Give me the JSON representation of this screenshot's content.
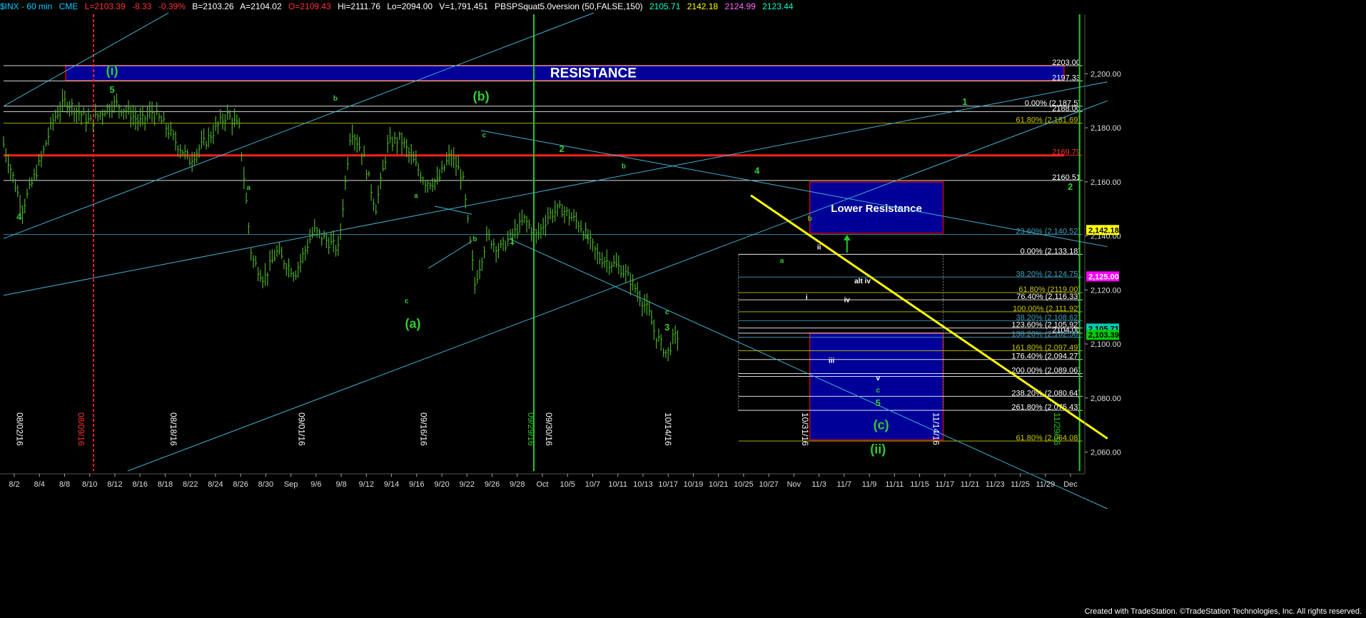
{
  "header": {
    "symbol": "$INX - 60 min",
    "exchange": "CME",
    "last": "L=2103.39",
    "change": "-8.33",
    "change_pct": "-0.39%",
    "bid": "B=2103.26",
    "ask": "A=2104.02",
    "open": "O=2109.43",
    "high": "Hi=2111.76",
    "low": "Lo=2094.00",
    "volume": "V=1,791,451",
    "study": "PBSPSquat5.0version (50,FALSE,150)",
    "study_values": [
      "2105.71",
      "2142.18",
      "2124.99",
      "2123.44"
    ],
    "colors": {
      "symbol": "#00ccff",
      "last": "#ff3333",
      "quotes": "#ffffff",
      "study": "#00ccff",
      "study_values": [
        "#00ffcc",
        "#ffff00",
        "#ff66ff",
        "#00ffcc"
      ]
    }
  },
  "footer": "Created with TradeStation. ©TradeStation Technologies, Inc. All rights reserved.",
  "chart_data": {
    "type": "candlestick",
    "title": "",
    "interval": "60 min",
    "x_ticks": [
      "8/2",
      "8/4",
      "8/8",
      "8/10",
      "8/12",
      "8/16",
      "8/18",
      "8/22",
      "8/24",
      "8/26",
      "8/30",
      "Sep",
      "9/6",
      "9/8",
      "9/12",
      "9/14",
      "9/16",
      "9/20",
      "9/22",
      "9/26",
      "9/28",
      "Oct",
      "10/5",
      "10/7",
      "10/11",
      "10/13",
      "10/17",
      "10/19",
      "10/21",
      "10/25",
      "10/27",
      "Nov",
      "11/3",
      "11/7",
      "11/9",
      "11/11",
      "11/15",
      "11/17",
      "11/21",
      "11/23",
      "11/25",
      "11/29",
      "Dec"
    ],
    "y_ticks": [
      2060,
      2080,
      2100,
      2120,
      2140,
      2160,
      2180,
      2200
    ],
    "ylim": [
      2053,
      2222
    ],
    "y_tick_labels": [
      "2,060.00",
      "2,080.00",
      "2,100.00",
      "2,120.00",
      "2,140.00",
      "2,160.00",
      "2,180.00",
      "2,200.00"
    ],
    "grid": false,
    "price_path": [
      [
        0,
        2174
      ],
      [
        3,
        2150
      ],
      [
        6,
        2168
      ],
      [
        8,
        2183
      ],
      [
        10,
        2190
      ],
      [
        12,
        2186
      ],
      [
        14,
        2182
      ],
      [
        16,
        2186
      ],
      [
        18,
        2189
      ],
      [
        20,
        2186
      ],
      [
        22,
        2182
      ],
      [
        24,
        2186
      ],
      [
        26,
        2181
      ],
      [
        28,
        2174
      ],
      [
        30,
        2168
      ],
      [
        33,
        2176
      ],
      [
        36,
        2185
      ],
      [
        38,
        2180
      ],
      [
        40,
        2132
      ],
      [
        42,
        2124
      ],
      [
        44,
        2134
      ],
      [
        47,
        2126
      ],
      [
        50,
        2142
      ],
      [
        54,
        2135
      ],
      [
        56,
        2180
      ],
      [
        58,
        2170
      ],
      [
        60,
        2150
      ],
      [
        62,
        2174
      ],
      [
        64,
        2176
      ],
      [
        66,
        2168
      ],
      [
        68,
        2160
      ],
      [
        70,
        2160
      ],
      [
        72,
        2170
      ],
      [
        74,
        2162
      ],
      [
        76,
        2122
      ],
      [
        78,
        2140
      ],
      [
        80,
        2135
      ],
      [
        82,
        2140
      ],
      [
        84,
        2146
      ],
      [
        86,
        2140
      ],
      [
        88,
        2148
      ],
      [
        90,
        2150
      ],
      [
        93,
        2144
      ],
      [
        96,
        2132
      ],
      [
        98,
        2130
      ],
      [
        99.5,
        2128
      ],
      [
        101,
        2124
      ],
      [
        102.5,
        2118
      ],
      [
        104,
        2112
      ],
      [
        105,
        2104
      ],
      [
        106,
        2100
      ],
      [
        107,
        2096
      ],
      [
        108,
        2102
      ],
      [
        109,
        2103.4
      ]
    ],
    "x_range": [
      0,
      174
    ],
    "vertical_date_labels": [
      "08/02/16",
      "08/09/16",
      "08/18/16",
      "09/01/16",
      "09/16/16",
      "09/29/16",
      "09/30/16",
      "10/14/16",
      "10/31/16",
      "11/14/16",
      "11/29/16"
    ],
    "horizontal_levels": [
      {
        "value": 2203.0,
        "label": "2203.00",
        "color": "#ffffff"
      },
      {
        "value": 2197.33,
        "label": "2197.33",
        "color": "#ffffff"
      },
      {
        "value": 2188.0,
        "label": "0.00% (2,187.5)",
        "color": "#ffffff"
      },
      {
        "value": 2186.0,
        "label": "2188.00",
        "color": "#ffffff"
      },
      {
        "value": 2181.69,
        "label": "61.80% (2,181.69)",
        "color": "#c8c800"
      },
      {
        "value": 2169.79,
        "label": "2169.79",
        "color": "#ff3030"
      },
      {
        "value": 2160.51,
        "label": "2160.51",
        "color": "#ffffff"
      },
      {
        "value": 2140.52,
        "label": "23.60% (2,140.52)",
        "color": "#40a0c0"
      },
      {
        "value": 2133.18,
        "label": "0.00% (2,133.18)",
        "color": "#ffffff"
      },
      {
        "value": 2124.75,
        "label": "38.20% (2,124.75)",
        "color": "#40a0c0"
      },
      {
        "value": 2119.0,
        "label": "61.80% (2119.00)",
        "color": "#c8c800"
      },
      {
        "value": 2116.33,
        "label": "76.40% (2,116.33)",
        "color": "#ffffff"
      },
      {
        "value": 2111.92,
        "label": "100.00% (2,111.92)",
        "color": "#c8c800"
      },
      {
        "value": 2108.62,
        "label": "38.20% (2,108.62)",
        "color": "#40a0c0"
      },
      {
        "value": 2105.92,
        "label": "123.60% (2,105.92)",
        "color": "#ffffff"
      },
      {
        "value": 2104.0,
        "label": "2104.00",
        "color": "#ffffff"
      },
      {
        "value": 2102.5,
        "label": "138.20% (2,102.50)",
        "color": "#40a0c0"
      },
      {
        "value": 2097.49,
        "label": "161.80% (2,097.49)",
        "color": "#c8c800"
      },
      {
        "value": 2094.27,
        "label": "176.40% (2,094.27)",
        "color": "#ffffff"
      },
      {
        "value": 2089.06,
        "label": "200.00% (2,089.06)",
        "color": "#ffffff"
      },
      {
        "value": 2088.0,
        "label": "",
        "color": "#ffffff"
      },
      {
        "value": 2080.64,
        "label": "238.20% (2,080.64)",
        "color": "#ffffff"
      },
      {
        "value": 2075.43,
        "label": "261.80% (2,075.43)",
        "color": "#ffffff"
      },
      {
        "value": 2064.08,
        "label": "61.80% (2,064.08)",
        "color": "#c8c800"
      }
    ],
    "price_tags": [
      {
        "value": 2142.18,
        "label": "2,142.18",
        "bg": "#ffff00",
        "fg": "#000000"
      },
      {
        "value": 2125.0,
        "label": "2,125.00",
        "bg": "#ff00ff",
        "fg": "#ffffff"
      },
      {
        "value": 2105.71,
        "label": "2,105.71",
        "bg": "#00ccaa",
        "fg": "#000000"
      },
      {
        "value": 2103.39,
        "label": "2,103.39",
        "bg": "#00cc00",
        "fg": "#000000"
      }
    ],
    "zones": [
      {
        "label": "RESISTANCE",
        "x0": 10,
        "x1": 171,
        "y0": 2197.5,
        "y1": 2203,
        "fill": "#000099",
        "stroke": "#cc0000"
      },
      {
        "label": "Lower Resistance",
        "x0": 130,
        "x1": 151.5,
        "y0": 2141,
        "y1": 2160,
        "fill": "#000099",
        "stroke": "#cc0000"
      },
      {
        "label": "",
        "x0": 130,
        "x1": 151.5,
        "y0": 2064.5,
        "y1": 2104,
        "fill": "#000099",
        "stroke": "#cc0000"
      }
    ],
    "annotations": [
      {
        "text": "(i)",
        "x": 17.5,
        "y": 2199.5,
        "color": "#33cc33",
        "size": 18
      },
      {
        "text": "5",
        "x": 17.5,
        "y": 2193,
        "color": "#33cc33",
        "size": 13
      },
      {
        "text": "4",
        "x": 2.5,
        "y": 2146,
        "color": "#33cc33",
        "size": 13
      },
      {
        "text": "b",
        "x": 53.5,
        "y": 2190,
        "color": "#33cc33",
        "size": 10
      },
      {
        "text": "a",
        "x": 39.5,
        "y": 2157,
        "color": "#33cc33",
        "size": 10
      },
      {
        "text": "(b)",
        "x": 77,
        "y": 2190,
        "color": "#33cc33",
        "size": 18
      },
      {
        "text": "c",
        "x": 77.5,
        "y": 2176.5,
        "color": "#33cc33",
        "size": 10
      },
      {
        "text": "2",
        "x": 90,
        "y": 2171,
        "color": "#33cc33",
        "size": 13
      },
      {
        "text": "b",
        "x": 100,
        "y": 2165,
        "color": "#33cc33",
        "size": 10
      },
      {
        "text": "a",
        "x": 66.5,
        "y": 2154,
        "color": "#33cc33",
        "size": 10
      },
      {
        "text": "b",
        "x": 76,
        "y": 2138,
        "color": "#33cc33",
        "size": 10
      },
      {
        "text": "1",
        "x": 82,
        "y": 2137,
        "color": "#33cc33",
        "size": 13
      },
      {
        "text": "a",
        "x": 94,
        "y": 2139,
        "color": "#33cc33",
        "size": 10
      },
      {
        "text": "c",
        "x": 65,
        "y": 2115,
        "color": "#33cc33",
        "size": 10
      },
      {
        "text": "(a)",
        "x": 66,
        "y": 2106,
        "color": "#33cc33",
        "size": 18
      },
      {
        "text": "c",
        "x": 107,
        "y": 2111,
        "color": "#33cc33",
        "size": 10
      },
      {
        "text": "3",
        "x": 107,
        "y": 2105,
        "color": "#33cc33",
        "size": 13
      },
      {
        "text": "4",
        "x": 121.5,
        "y": 2163,
        "color": "#33cc33",
        "size": 13
      },
      {
        "text": "b",
        "x": 130,
        "y": 2145.5,
        "color": "#33cc33",
        "size": 10
      },
      {
        "text": "a",
        "x": 125.5,
        "y": 2130,
        "color": "#33cc33",
        "size": 10
      },
      {
        "text": "ii",
        "x": 131.5,
        "y": 2135,
        "color": "#ffffff",
        "size": 10
      },
      {
        "text": "i",
        "x": 129.5,
        "y": 2116.5,
        "color": "#ffffff",
        "size": 10
      },
      {
        "text": "alt iv",
        "x": 138.5,
        "y": 2122.5,
        "color": "#ffffff",
        "size": 10
      },
      {
        "text": "iv",
        "x": 136,
        "y": 2115.5,
        "color": "#ffffff",
        "size": 10
      },
      {
        "text": "iii",
        "x": 133.5,
        "y": 2093,
        "color": "#ffffff",
        "size": 10
      },
      {
        "text": "v",
        "x": 141,
        "y": 2086.5,
        "color": "#ffffff",
        "size": 10
      },
      {
        "text": "c",
        "x": 141,
        "y": 2082,
        "color": "#33cc33",
        "size": 10
      },
      {
        "text": "5",
        "x": 141,
        "y": 2077,
        "color": "#33cc33",
        "size": 13
      },
      {
        "text": "(c)",
        "x": 141.5,
        "y": 2068.5,
        "color": "#33cc33",
        "size": 18
      },
      {
        "text": "(ii)",
        "x": 141,
        "y": 2059.5,
        "color": "#33cc33",
        "size": 18
      },
      {
        "text": "1",
        "x": 155,
        "y": 2188.5,
        "color": "#33cc33",
        "size": 13
      },
      {
        "text": "2",
        "x": 172,
        "y": 2157,
        "color": "#33cc33",
        "size": 13
      }
    ],
    "trendlines": [
      {
        "x0": 0,
        "y0": 2188,
        "x1": 28.5,
        "y1": 2225,
        "color": "#40b0d0",
        "width": 1
      },
      {
        "x0": 0,
        "y0": 2139,
        "x1": 98,
        "y1": 2225,
        "color": "#40b0d0",
        "width": 1
      },
      {
        "x0": 0,
        "y0": 2118,
        "x1": 178,
        "y1": 2197,
        "color": "#40b0d0",
        "width": 1
      },
      {
        "x0": 20,
        "y0": 2053,
        "x1": 178,
        "y1": 2190,
        "color": "#40b0d0",
        "width": 1
      },
      {
        "x0": 77,
        "y0": 2179,
        "x1": 178,
        "y1": 2136,
        "color": "#40b0d0",
        "width": 1
      },
      {
        "x0": 81.5,
        "y0": 2139,
        "x1": 178,
        "y1": 2039,
        "color": "#40b0d0",
        "width": 1
      },
      {
        "x0": 68.5,
        "y0": 2128,
        "x1": 75.5,
        "y1": 2138,
        "color": "#40b0d0",
        "width": 1
      },
      {
        "x0": 69.5,
        "y0": 2151,
        "x1": 75.5,
        "y1": 2148,
        "color": "#40b0d0",
        "width": 1
      },
      {
        "x0": 120.5,
        "y0": 2155,
        "x1": 178,
        "y1": 2065,
        "color": "#ffff00",
        "width": 3
      }
    ],
    "vertical_lines": [
      {
        "x": 14.5,
        "color": "#ff2020",
        "dash": "4,3"
      },
      {
        "x": 85.5,
        "color": "#22cc22",
        "dash": ""
      },
      {
        "x": 173.5,
        "color": "#22cc22",
        "dash": ""
      }
    ],
    "red_hline": {
      "value": 2169.79,
      "x0": 0,
      "x1": 171
    },
    "up_arrow": {
      "x": 136,
      "y": 2137
    },
    "fib_box": {
      "x0": 118.5,
      "x1": 151.5,
      "y0": 2075.43,
      "y1": 2133.18
    }
  }
}
